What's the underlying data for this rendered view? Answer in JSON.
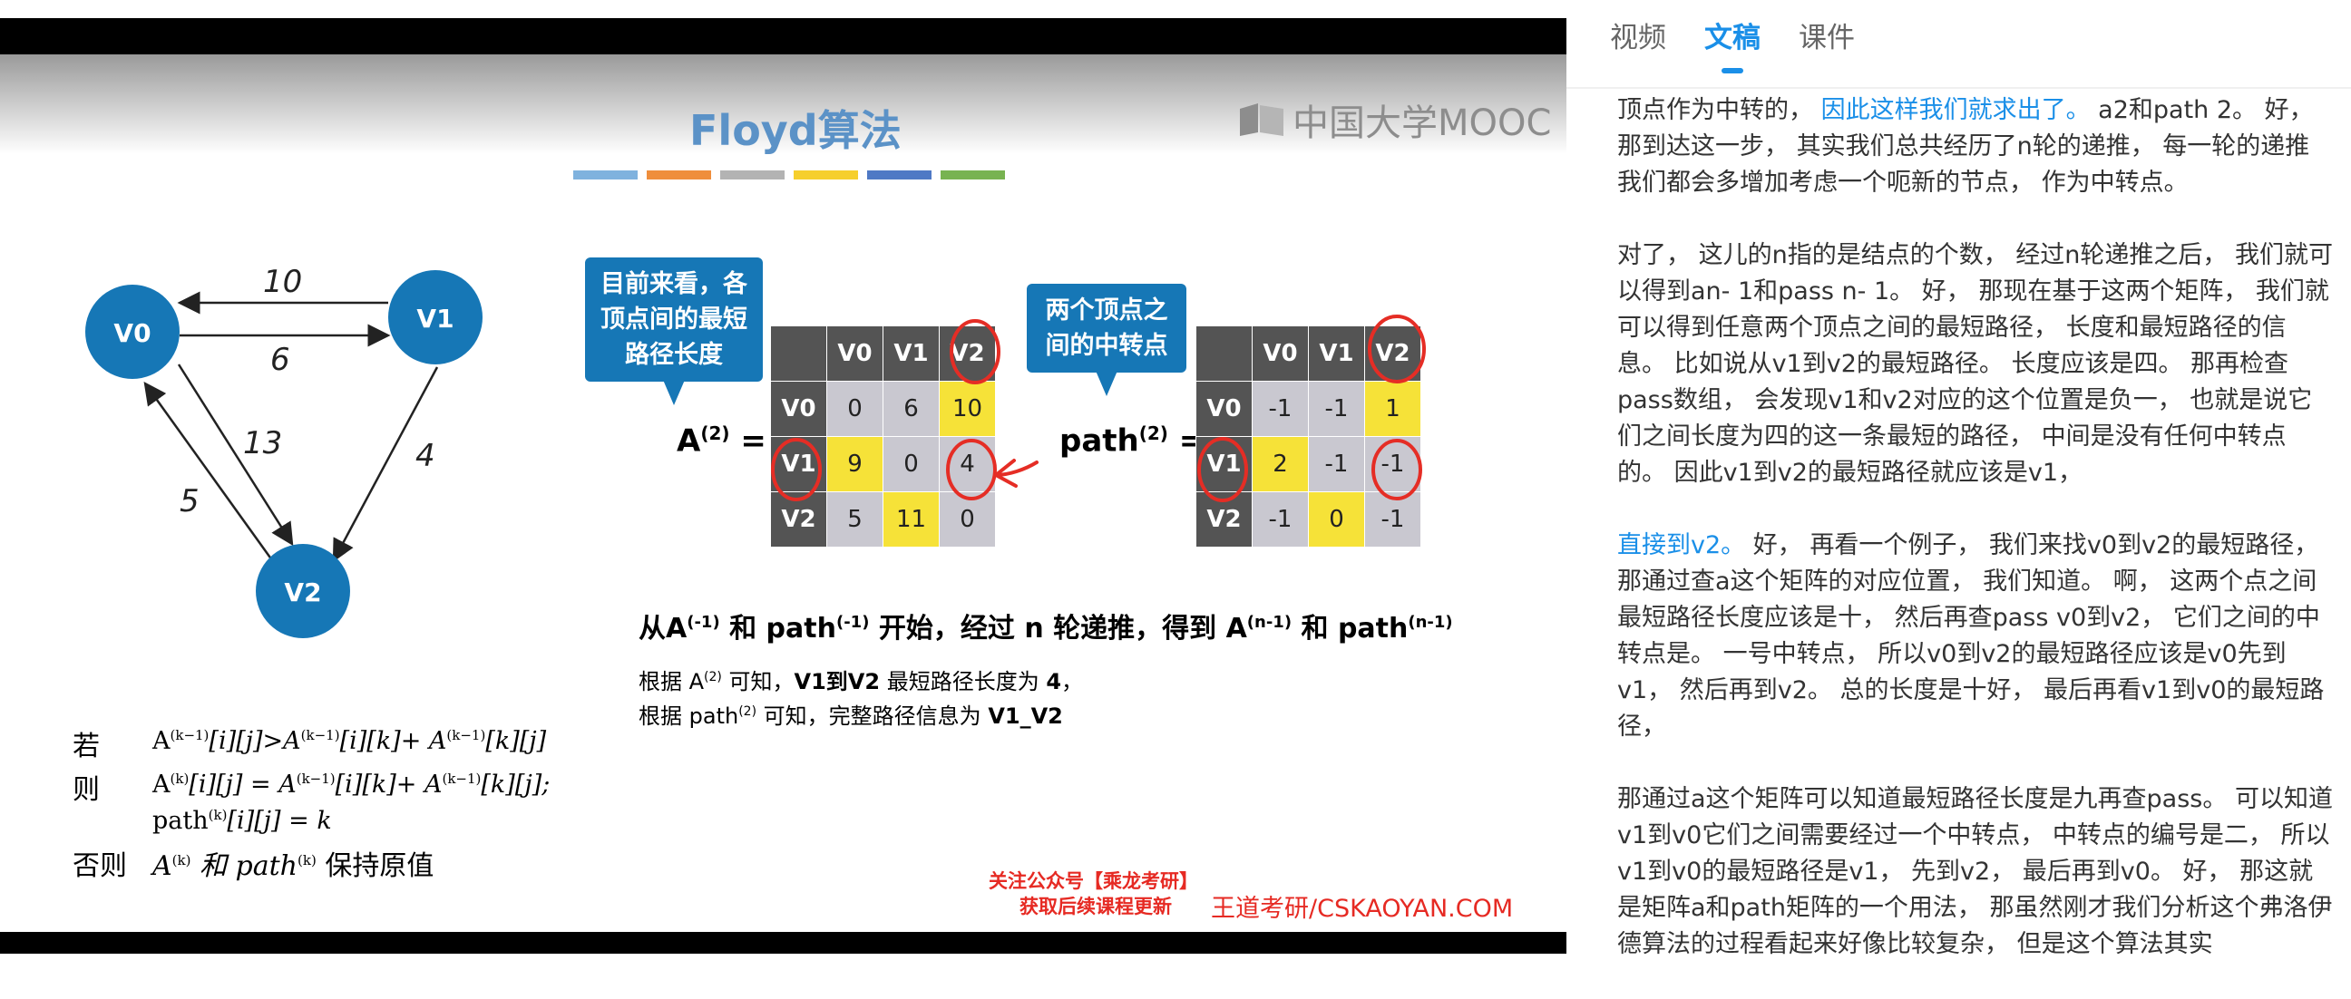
{
  "slide": {
    "title": "Floyd算法",
    "logo_text": "中国大学MOOC",
    "color_bars": [
      "#7fb2de",
      "#ef8e3c",
      "#b3b3b3",
      "#f6cf2c",
      "#4f79c5",
      "#78b351"
    ],
    "graph": {
      "nodes": [
        "V0",
        "V1",
        "V2"
      ],
      "edge_labels": {
        "v1_v0": "10",
        "v0_v1": "6",
        "v0_v2": "13",
        "v2_v0": "5",
        "v1_v2": "4"
      },
      "node_color": "#1677b6"
    },
    "callout_a": "目前来看，各顶点间的最短路径长度",
    "callout_p": "两个顶点之间的中转点",
    "matrix_a": {
      "label": "A",
      "sup": "(2)",
      "suffix": "=",
      "cols": [
        "V0",
        "V1",
        "V2"
      ],
      "rows": [
        {
          "head": "V0",
          "cells": [
            "0",
            "6",
            "10"
          ]
        },
        {
          "head": "V1",
          "cells": [
            "9",
            "0",
            "4"
          ]
        },
        {
          "head": "V2",
          "cells": [
            "5",
            "11",
            "0"
          ]
        }
      ]
    },
    "matrix_path": {
      "label": "path",
      "sup": "(2)",
      "suffix": "=",
      "cols": [
        "V0",
        "V1",
        "V2"
      ],
      "rows": [
        {
          "head": "V0",
          "cells": [
            "-1",
            "-1",
            "1"
          ]
        },
        {
          "head": "V1",
          "cells": [
            "2",
            "-1",
            "-1"
          ]
        },
        {
          "head": "V2",
          "cells": [
            "-1",
            "0",
            "-1"
          ]
        }
      ]
    },
    "line1": {
      "p1": "从A",
      "s1": "(-1)",
      "p2": " 和 path",
      "s2": "(-1)",
      "p3": " 开始，经过 n 轮递推，得到 A",
      "s3": "(n-1)",
      "p4": " 和 path",
      "s4": "(n-1)"
    },
    "note1": {
      "p1": "根据 A",
      "s1": "(2)",
      "p2": " 可知，",
      "b": "V1到V2",
      "p3": " 最短路径长度为 ",
      "b2": "4",
      "p4": "，"
    },
    "note2": {
      "p1": "根据 path",
      "s1": "(2)",
      "p2": "  可知，完整路径信息为 ",
      "b": "V1_V2"
    },
    "rules": {
      "if_key": "若",
      "if_val": {
        "a": "A",
        "sa": "(k−1)",
        "b": "[i][j]>A",
        "sb": "(k−1)",
        "c": "[i][k]+ A",
        "sc": "(k−1)",
        "d": "[k][j]"
      },
      "then_key": "则",
      "then_val1": {
        "a": "A",
        "sa": "(k)",
        "b": "[i][j] = A",
        "sb": "(k−1)",
        "c": "[i][k]+ A",
        "sc": "(k−1)",
        "d": "[k][j];"
      },
      "then_val2": {
        "a": "path",
        "sa": "(k)",
        "b": "[i][j] = k"
      },
      "else_key": "否则",
      "else_val": {
        "a": "A",
        "sa": "(k)",
        "b": " 和 path",
        "sb": "(k)",
        "c": " 保持原值"
      }
    },
    "watermark_line1": "关注公众号【乘龙考研】",
    "watermark_line2": "获取后续课程更新",
    "watermark_site": "王道考研/CSKAOYAN.COM"
  },
  "sidebar": {
    "tabs": [
      {
        "label": "视频",
        "active": false
      },
      {
        "label": "文稿",
        "active": true
      },
      {
        "label": "课件",
        "active": false
      }
    ],
    "accent": "#1a8fe8",
    "paragraphs": [
      {
        "segments": [
          {
            "text": "顶点作为中转的， ",
            "hl": false
          },
          {
            "text": "因此这样我们就求出了。",
            "hl": true
          },
          {
            "text": " a2和path 2。 好， 那到达这一步， 其实我们总共经历了n轮的递推， 每一轮的递推我们都会多增加考虑一个呃新的节点， 作为中转点。",
            "hl": false
          }
        ]
      },
      {
        "segments": [
          {
            "text": "对了， 这儿的n指的是结点的个数， 经过n轮递推之后， 我们就可以得到an- 1和pass n- 1。 好， 那现在基于这两个矩阵， 我们就可以得到任意两个顶点之间的最短路径， 长度和最短路径的信息。 比如说从v1到v2的最短路径。 长度应该是四。 那再检查pass数组， 会发现v1和v2对应的这个位置是负一， 也就是说它们之间长度为四的这一条最短的路径， 中间是没有任何中转点的。 因此v1到v2的最短路径就应该是v1，",
            "hl": false
          }
        ]
      },
      {
        "segments": [
          {
            "text": "直接到v2。",
            "hl": true
          },
          {
            "text": " 好， 再看一个例子， 我们来找v0到v2的最短路径， 那通过查a这个矩阵的对应位置， 我们知道。 啊， 这两个点之间最短路径长度应该是十， 然后再查pass v0到v2， 它们之间的中转点是。 一号中转点， 所以v0到v2的最短路径应该是v0先到v1， 然后再到v2。 总的长度是十好， 最后再看v1到v0的最短路径，",
            "hl": false
          }
        ]
      },
      {
        "segments": [
          {
            "text": "那通过a这个矩阵可以知道最短路径长度是九再查pass。 可以知道v1到v0它们之间需要经过一个中转点， 中转点的编号是二， 所以v1到v0的最短路径是v1， 先到v2， 最后再到v0。 好， 那这就是矩阵a和path矩阵的一个用法， 那虽然刚才我们分析这个弗洛伊德算法的过程看起来好像比较复杂， 但是这个算法其实",
            "hl": false
          }
        ]
      }
    ]
  }
}
